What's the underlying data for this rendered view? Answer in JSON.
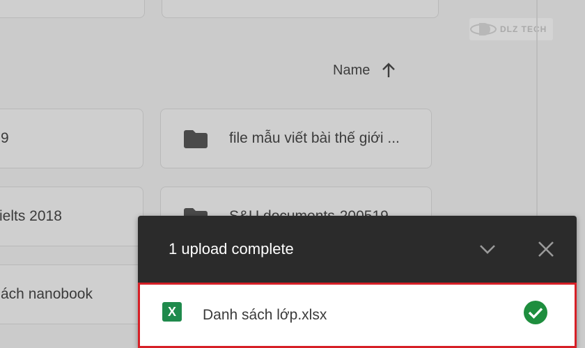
{
  "sort": {
    "label": "Name",
    "direction_icon": "arrow-up-icon"
  },
  "watermark": {
    "text": "DLZ TECH"
  },
  "folders": [
    {
      "label": "9"
    },
    {
      "label": "file mẫu viết bài thế giới ..."
    },
    {
      "label": "ielts 2018"
    },
    {
      "label": "S&U documents-200519"
    },
    {
      "label": "ách nanobook"
    }
  ],
  "upload_panel": {
    "title": "1 upload complete",
    "collapse_icon": "chevron-down-icon",
    "close_icon": "close-icon",
    "file": {
      "name": "Danh sách lớp.xlsx",
      "type_icon": "excel-icon",
      "type_letter": "X",
      "status_icon": "check-circle-icon"
    }
  },
  "colors": {
    "header_bg": "#2b2b2b",
    "highlight_border": "#d61f26",
    "excel_green": "#1f8a4c",
    "check_green": "#1e8e3e"
  }
}
